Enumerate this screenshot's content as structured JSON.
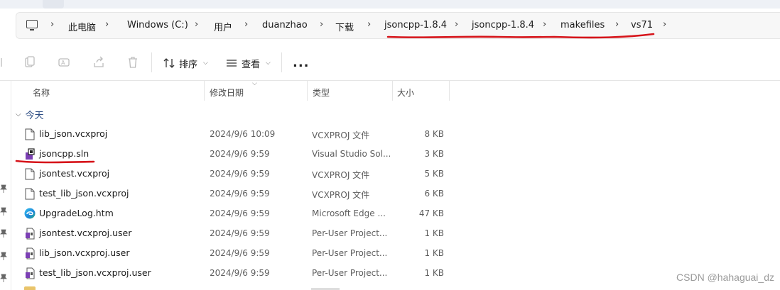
{
  "breadcrumb": {
    "items": [
      "此电脑",
      "Windows (C:)",
      "用户",
      "duanzhao",
      "下载",
      "jsoncpp-1.8.4",
      "jsoncpp-1.8.4",
      "makefiles",
      "vs71"
    ]
  },
  "toolbar": {
    "sort_label": "排序",
    "view_label": "查看",
    "more_label": "..."
  },
  "columns": {
    "name": "名称",
    "date": "修改日期",
    "type": "类型",
    "size": "大小"
  },
  "group": {
    "label": "今天"
  },
  "files": [
    {
      "name": "lib_json.vcxproj",
      "date": "2024/9/6 10:09",
      "type": "VCXPROJ 文件",
      "size": "8 KB",
      "icon": "document-icon"
    },
    {
      "name": "jsoncpp.sln",
      "date": "2024/9/6 9:59",
      "type": "Visual Studio Sol...",
      "size": "3 KB",
      "icon": "visual-studio-solution-icon"
    },
    {
      "name": "jsontest.vcxproj",
      "date": "2024/9/6 9:59",
      "type": "VCXPROJ 文件",
      "size": "5 KB",
      "icon": "document-icon"
    },
    {
      "name": "test_lib_json.vcxproj",
      "date": "2024/9/6 9:59",
      "type": "VCXPROJ 文件",
      "size": "6 KB",
      "icon": "document-icon"
    },
    {
      "name": "UpgradeLog.htm",
      "date": "2024/9/6 9:59",
      "type": "Microsoft Edge ...",
      "size": "47 KB",
      "icon": "edge-icon"
    },
    {
      "name": "jsontest.vcxproj.user",
      "date": "2024/9/6 9:59",
      "type": "Per-User Project...",
      "size": "1 KB",
      "icon": "vs-project-user-icon"
    },
    {
      "name": "lib_json.vcxproj.user",
      "date": "2024/9/6 9:59",
      "type": "Per-User Project...",
      "size": "1 KB",
      "icon": "vs-project-user-icon"
    },
    {
      "name": "test_lib_json.vcxproj.user",
      "date": "2024/9/6 9:59",
      "type": "Per-User Project...",
      "size": "1 KB",
      "icon": "vs-project-user-icon"
    }
  ],
  "watermark": "CSDN @hahaguai_dz",
  "colors": {
    "annotation_red": "#d6141a",
    "group_blue": "#2d4d84",
    "vs_purple": "#7b3fb4"
  }
}
